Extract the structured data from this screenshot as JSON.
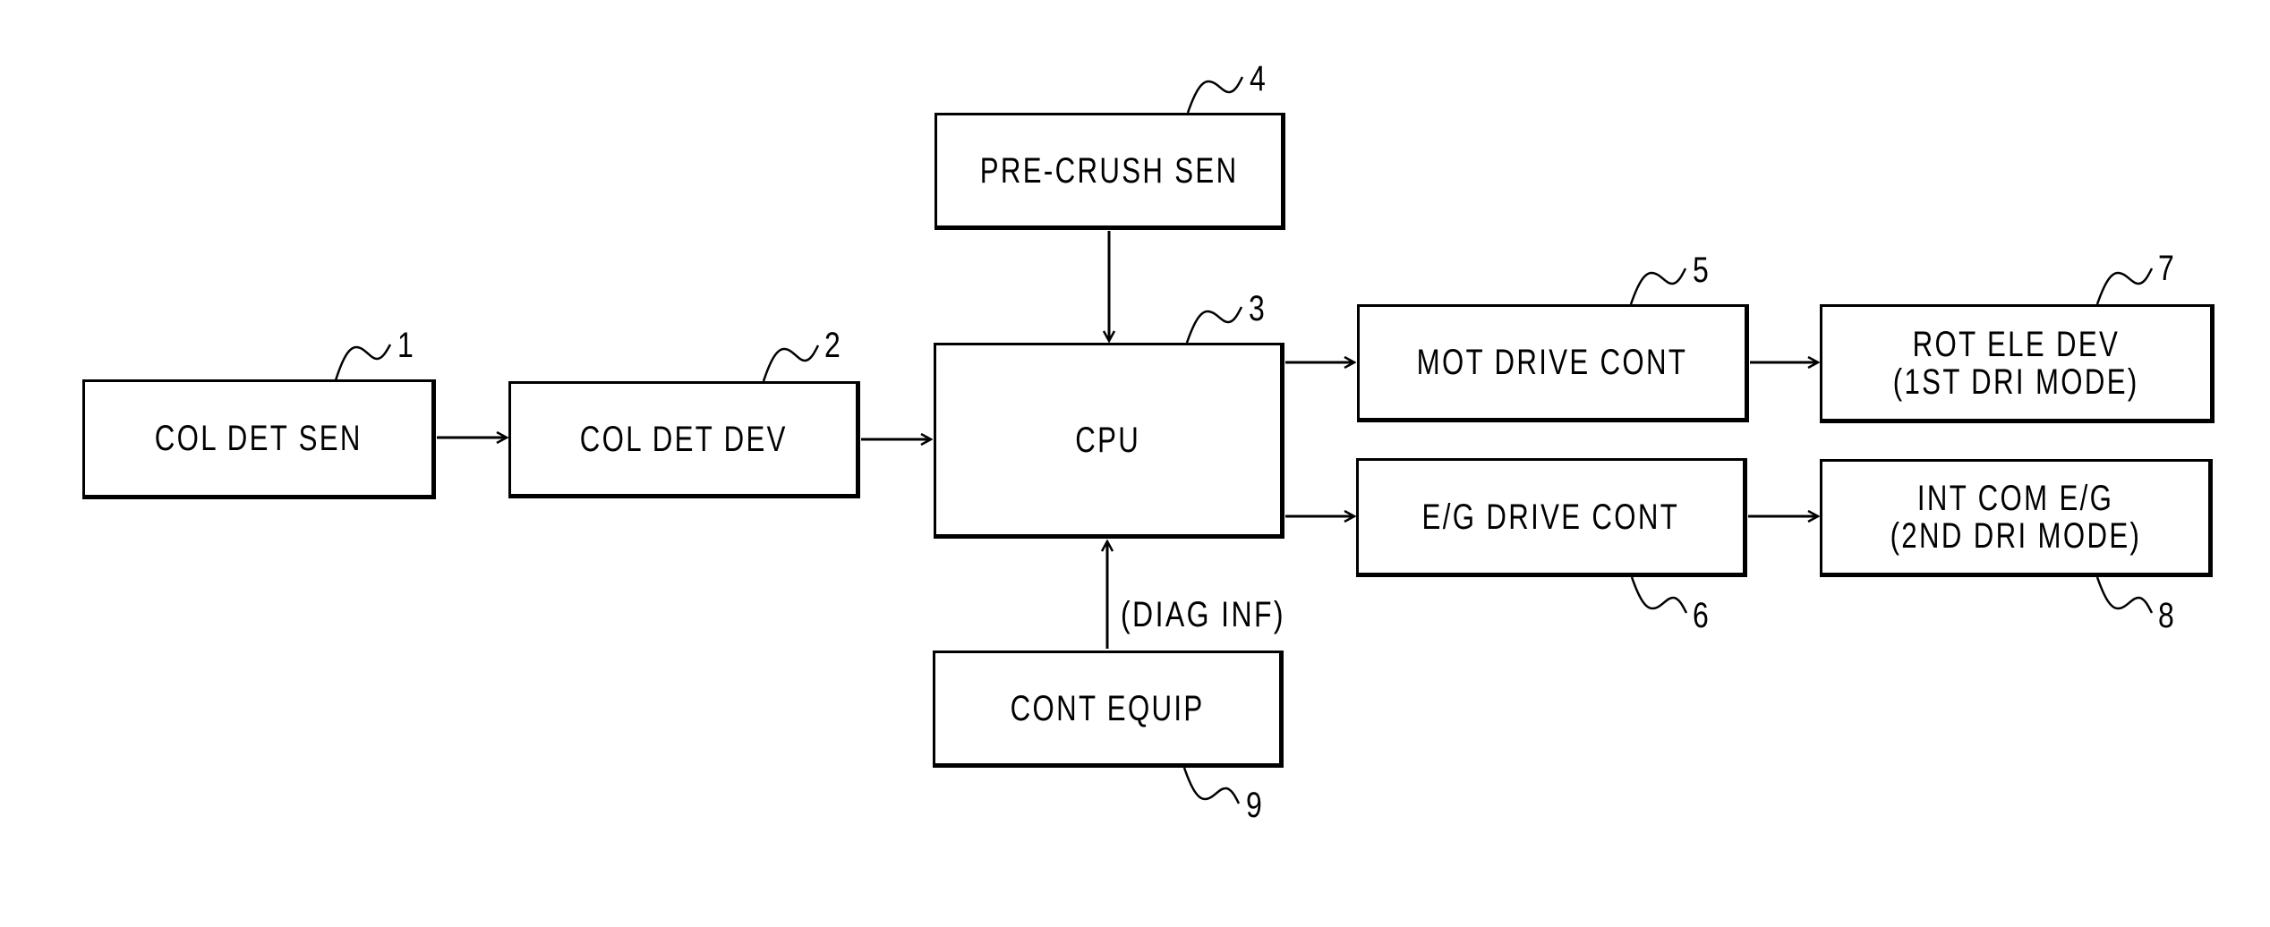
{
  "diagram": {
    "type": "block-diagram",
    "blocks": [
      {
        "id": "1",
        "ref": "1",
        "lines": [
          "COL DET SEN"
        ]
      },
      {
        "id": "2",
        "ref": "2",
        "lines": [
          "COL DET DEV"
        ]
      },
      {
        "id": "3",
        "ref": "3",
        "lines": [
          "CPU"
        ]
      },
      {
        "id": "4",
        "ref": "4",
        "lines": [
          "PRE-CRUSH SEN"
        ]
      },
      {
        "id": "5",
        "ref": "5",
        "lines": [
          "MOT DRIVE CONT"
        ]
      },
      {
        "id": "6",
        "ref": "6",
        "lines": [
          "E/G DRIVE CONT"
        ]
      },
      {
        "id": "7",
        "ref": "7",
        "lines": [
          "ROT ELE DEV",
          "(1ST DRI MODE)"
        ]
      },
      {
        "id": "8",
        "ref": "8",
        "lines": [
          "INT COM E/G",
          "(2ND DRI MODE)"
        ]
      },
      {
        "id": "9",
        "ref": "9",
        "lines": [
          "CONT EQUIP"
        ]
      }
    ],
    "connections": [
      {
        "from": "1",
        "to": "2",
        "label": ""
      },
      {
        "from": "2",
        "to": "3",
        "label": ""
      },
      {
        "from": "4",
        "to": "3",
        "label": ""
      },
      {
        "from": "9",
        "to": "3",
        "label": "(DIAG INF)"
      },
      {
        "from": "3",
        "to": "5",
        "label": ""
      },
      {
        "from": "3",
        "to": "6",
        "label": ""
      },
      {
        "from": "5",
        "to": "7",
        "label": ""
      },
      {
        "from": "6",
        "to": "8",
        "label": ""
      }
    ]
  }
}
